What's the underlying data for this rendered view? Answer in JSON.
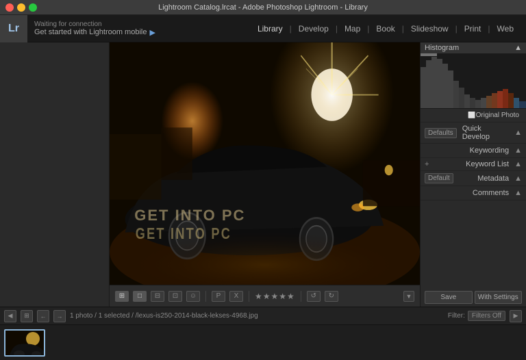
{
  "titlebar": {
    "title": "Lightroom Catalog.lrcat - Adobe Photoshop Lightroom - Library"
  },
  "topbar": {
    "logo": "Lr",
    "connection": {
      "waiting": "Waiting for connection",
      "started": "Get started with Lightroom mobile"
    },
    "nav": [
      {
        "label": "Library",
        "active": true
      },
      {
        "label": "Develop",
        "active": false
      },
      {
        "label": "Map",
        "active": false
      },
      {
        "label": "Book",
        "active": false
      },
      {
        "label": "Slideshow",
        "active": false
      },
      {
        "label": "Print",
        "active": false
      },
      {
        "label": "Web",
        "active": false
      }
    ]
  },
  "right_panel": {
    "histogram_label": "Histogram",
    "original_photo": "Original Photo",
    "items": [
      {
        "label": "Quick Develop",
        "badge": "Defaults"
      },
      {
        "label": "Keywording"
      },
      {
        "label": "Keyword List"
      },
      {
        "label": "Metadata",
        "badge": "Default"
      },
      {
        "label": "Comments"
      }
    ]
  },
  "toolbar": {
    "icons": [
      "grid",
      "loupe",
      "compare",
      "survey",
      "people"
    ],
    "stars": "★★★★★",
    "flag_icons": [
      "flag",
      "unflag"
    ],
    "rotation_icons": [
      "rotate-left",
      "rotate-right"
    ],
    "extras": [
      "extras"
    ]
  },
  "filmstrip_bar": {
    "buttons": [
      "left",
      "grid",
      "left-nav",
      "right-nav"
    ],
    "info": "1 photo / 1 selected",
    "path": "/lexus-is250-2014-black-lekses-4968.jpg",
    "filter_label": "Filter:",
    "filter_value": "Filters Off"
  },
  "filmstrip": {
    "thumbs": [
      1
    ]
  },
  "panel_buttons": {
    "left": "Save",
    "right": "With Settings"
  }
}
